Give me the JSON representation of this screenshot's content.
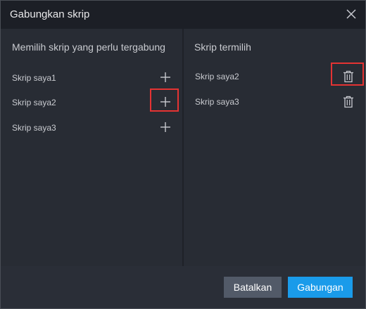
{
  "dialog": {
    "title": "Gabungkan skrip",
    "close_icon": "close-icon"
  },
  "left_panel": {
    "header": "Memilih skrip yang perlu tergabung",
    "items": [
      {
        "label": "Skrip saya1",
        "icon": "plus-icon",
        "highlighted": false
      },
      {
        "label": "Skrip saya2",
        "icon": "plus-icon",
        "highlighted": true
      },
      {
        "label": "Skrip saya3",
        "icon": "plus-icon",
        "highlighted": false
      }
    ]
  },
  "right_panel": {
    "header": "Skrip termilih",
    "items": [
      {
        "label": "Skrip saya2",
        "icon": "trash-icon",
        "highlighted": true
      },
      {
        "label": "Skrip saya3",
        "icon": "trash-icon",
        "highlighted": false
      }
    ]
  },
  "footer": {
    "cancel_label": "Batalkan",
    "merge_label": "Gabungan"
  },
  "colors": {
    "accent": "#1a9bea",
    "highlight": "#e53333"
  }
}
